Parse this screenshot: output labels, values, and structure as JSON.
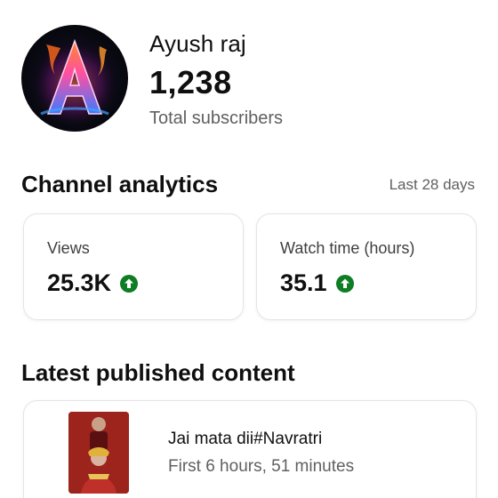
{
  "channel": {
    "name": "Ayush raj",
    "subscriber_count": "1,238",
    "subscriber_label": "Total subscribers",
    "avatar_icon": "flaming-letter-a-avatar"
  },
  "analytics": {
    "title": "Channel analytics",
    "period": "Last 28 days",
    "metrics": [
      {
        "label": "Views",
        "value": "25.3K",
        "trend_icon": "arrow-up-circle-icon",
        "trend_color": "#0f7d23"
      },
      {
        "label": "Watch time (hours)",
        "value": "35.1",
        "trend_icon": "arrow-up-circle-icon",
        "trend_color": "#0f7d23"
      }
    ]
  },
  "latest": {
    "title": "Latest published content",
    "video": {
      "title": "Jai mata dii#Navratri",
      "stat": "First 6 hours, 51 minutes"
    }
  }
}
